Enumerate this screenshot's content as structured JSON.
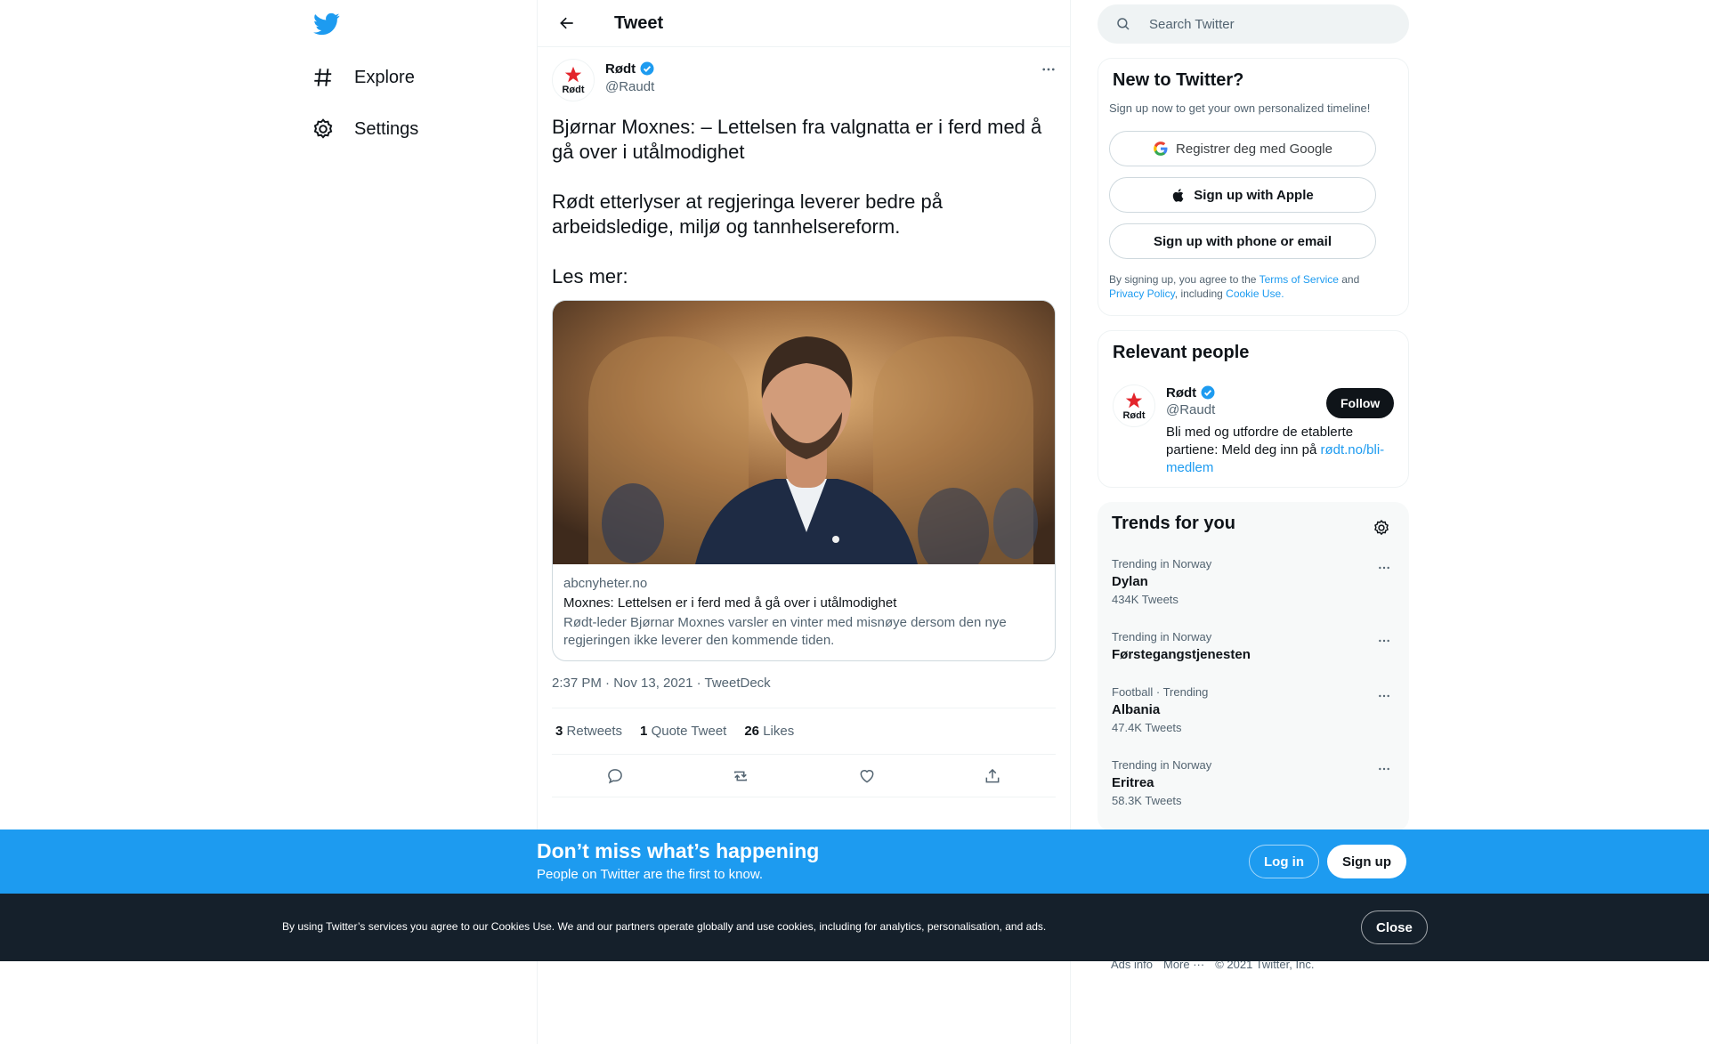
{
  "nav": {
    "items": [
      {
        "label": "Explore",
        "icon": "hashtag-icon"
      },
      {
        "label": "Settings",
        "icon": "gear-icon"
      }
    ]
  },
  "header": {
    "title": "Tweet"
  },
  "tweet": {
    "author_name": "Rødt",
    "author_handle": "@Raudt",
    "avatar_text": "Rødt",
    "text_p1": "Bjørnar Moxnes: – Lettelsen fra valgnatta er i ferd med å gå over i utålmodighet",
    "text_p2": "Rødt etterlyser at regjeringa leverer bedre på arbeidsledige, miljø og tannhelsereform.",
    "text_p3": "Les mer:",
    "card": {
      "domain": "abcnyheter.no",
      "title": "Moxnes: Lettelsen er i ferd med å gå over i utålmodighet",
      "description": "Rødt-leder Bjørnar Moxnes varsler en vinter med misnøye dersom den nye regjeringen ikke leverer den kommende tiden."
    },
    "timestamp": "2:37 PM · Nov 13, 2021 · TweetDeck",
    "stats": {
      "retweets_count": "3",
      "retweets_label": "Retweets",
      "quotes_count": "1",
      "quotes_label": "Quote Tweet",
      "likes_count": "26",
      "likes_label": "Likes"
    }
  },
  "search": {
    "placeholder": "Search Twitter"
  },
  "signup_panel": {
    "title": "New to Twitter?",
    "subtitle": "Sign up now to get your own personalized timeline!",
    "google_label": "Registrer deg med Google",
    "apple_label": "Sign up with Apple",
    "phone_label": "Sign up with phone or email",
    "legal_prefix": "By signing up, you agree to the ",
    "terms": "Terms of Service",
    "and": " and",
    "privacy": "Privacy Policy",
    "including": ", including ",
    "cookie": "Cookie Use."
  },
  "relevant": {
    "title": "Relevant people",
    "name": "Rødt",
    "handle": "@Raudt",
    "follow_label": "Follow",
    "bio": "Bli med og utfordre de etablerte partiene: Meld deg inn på ",
    "bio_link": "rødt.no/bli-medlem"
  },
  "trends": {
    "title": "Trends for you",
    "items": [
      {
        "category": "Trending in Norway",
        "name": "Dylan",
        "count": "434K Tweets"
      },
      {
        "category": "Trending in Norway",
        "name": "Førstegangstjenesten",
        "count": ""
      },
      {
        "category": "Football · Trending",
        "name": "Albania",
        "count": "47.4K Tweets"
      },
      {
        "category": "Trending in Norway",
        "name": "Eritrea",
        "count": "58.3K Tweets"
      }
    ]
  },
  "footer": {
    "ads": "Ads info",
    "more": "More ···",
    "copyright": "© 2021 Twitter, Inc."
  },
  "banner": {
    "headline": "Don’t miss what’s happening",
    "sub": "People on Twitter are the first to know.",
    "login": "Log in",
    "signup": "Sign up"
  },
  "cookie_bar": {
    "text": "By using Twitter’s services you agree to our Cookies Use. We and our partners operate globally and use cookies, including for analytics, personalisation, and ads.",
    "close": "Close"
  },
  "colors": {
    "brand": "#1d9bf0",
    "text": "#0f1419",
    "muted": "#536471",
    "rodt_red": "#e3242b"
  }
}
